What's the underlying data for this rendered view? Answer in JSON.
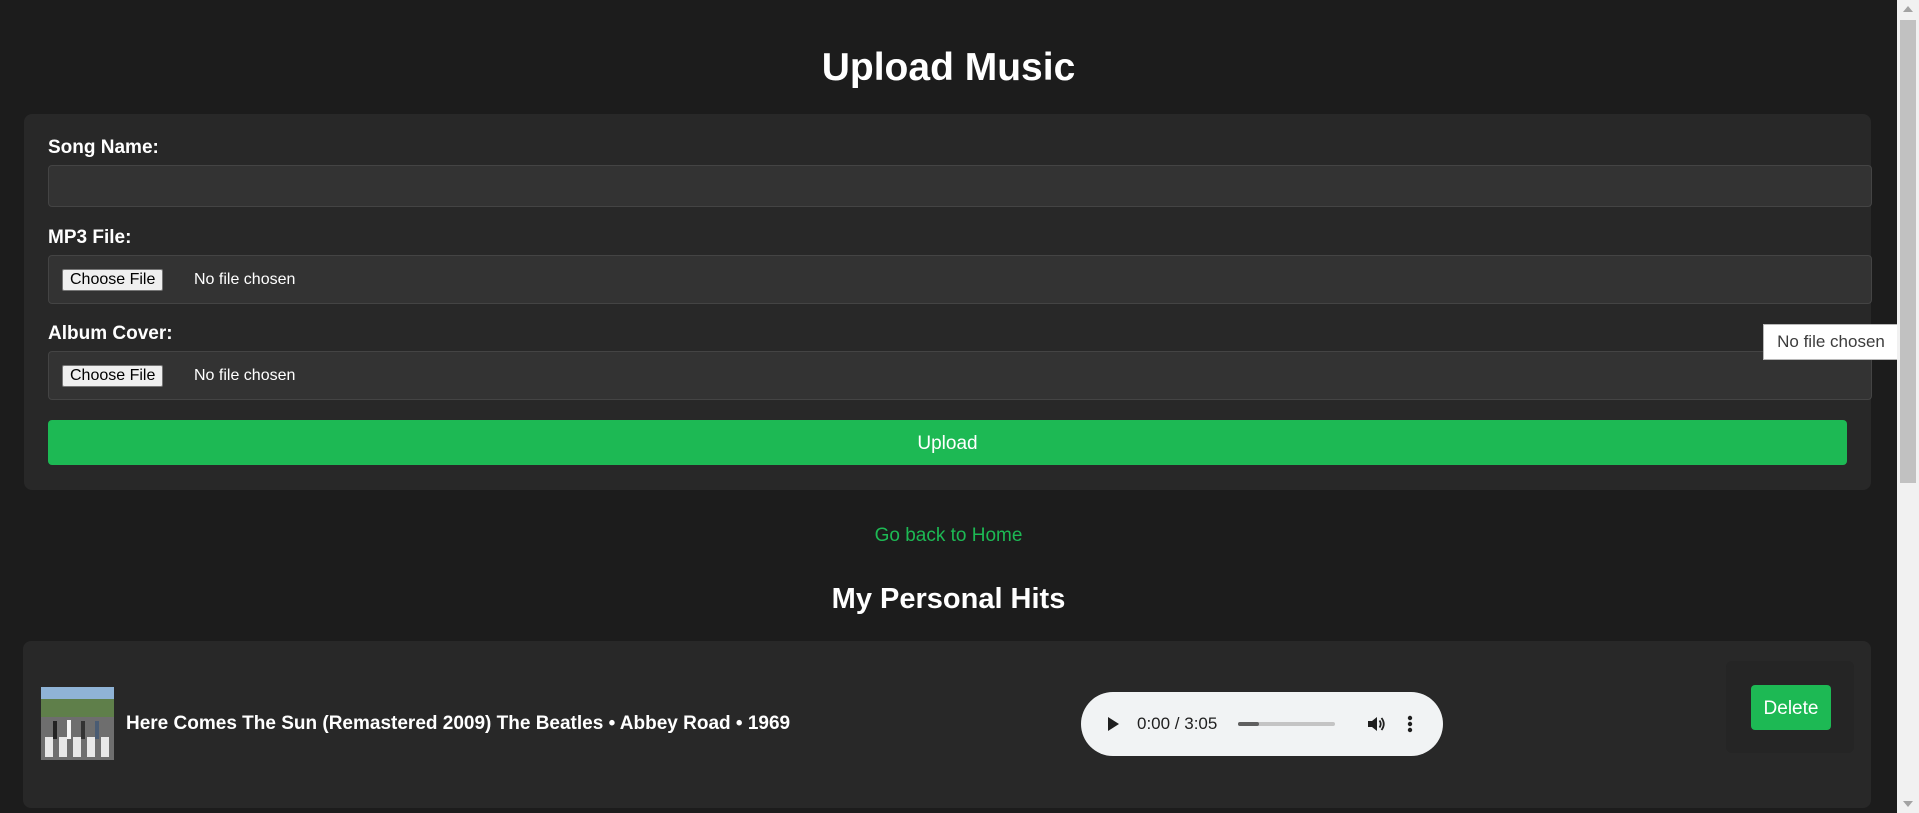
{
  "page": {
    "title": "Upload Music",
    "back_link": "Go back to Home",
    "section_title": "My Personal Hits"
  },
  "form": {
    "song_name_label": "Song Name:",
    "song_name_value": "",
    "mp3_label": "MP3 File:",
    "mp3_button": "Choose File",
    "mp3_status": "No file chosen",
    "cover_label": "Album Cover:",
    "cover_button": "Choose File",
    "cover_status": "No file chosen",
    "upload_button": "Upload",
    "tooltip": "No file chosen"
  },
  "songs": [
    {
      "title": "Here Comes The Sun (Remastered 2009) The Beatles • Abbey Road • 1969",
      "player": {
        "time": "0:00 / 3:05",
        "progress": 0.22
      },
      "delete_label": "Delete"
    }
  ],
  "colors": {
    "background": "#1c1c1c",
    "card": "#282828",
    "accent": "#1db954"
  },
  "icons": {
    "play": "play-icon",
    "volume": "volume-icon",
    "more": "more-vertical-icon"
  }
}
